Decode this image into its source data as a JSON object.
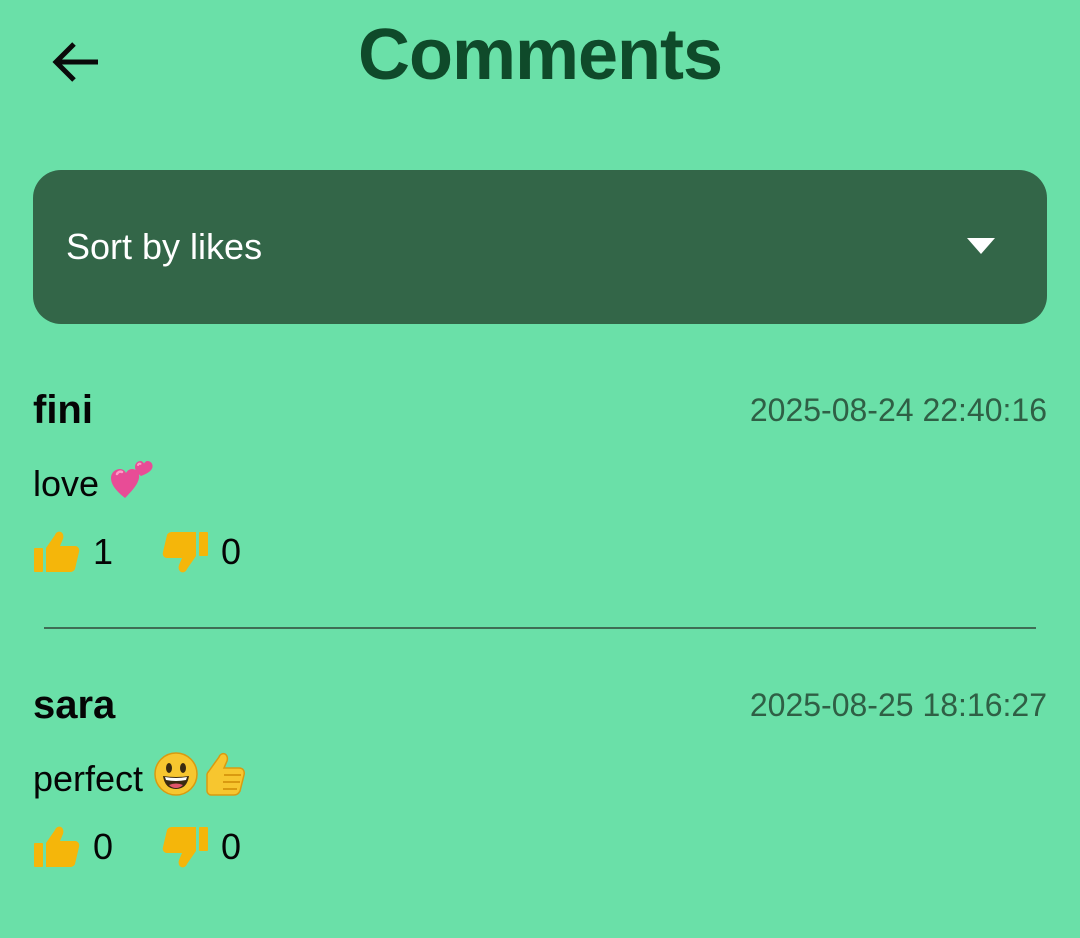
{
  "header": {
    "title": "Comments",
    "back_icon": "arrow-left-icon"
  },
  "sort": {
    "selected": "Sort by likes",
    "icon": "caret-down-icon"
  },
  "colors": {
    "background": "#6ae0a8",
    "title": "#0f4a2a",
    "select_bg": "#336648",
    "reaction": "#f5b60a"
  },
  "comments": [
    {
      "author": "fini",
      "timestamp": "2025-08-24 22:40:16",
      "text": "love",
      "emojis": [
        "two-hearts-icon"
      ],
      "likes": "1",
      "dislikes": "0"
    },
    {
      "author": "sara",
      "timestamp": "2025-08-25 18:16:27",
      "text": "perfect",
      "emojis": [
        "grinning-face-icon",
        "thumbs-up-emoji-icon"
      ],
      "likes": "0",
      "dislikes": "0"
    }
  ]
}
